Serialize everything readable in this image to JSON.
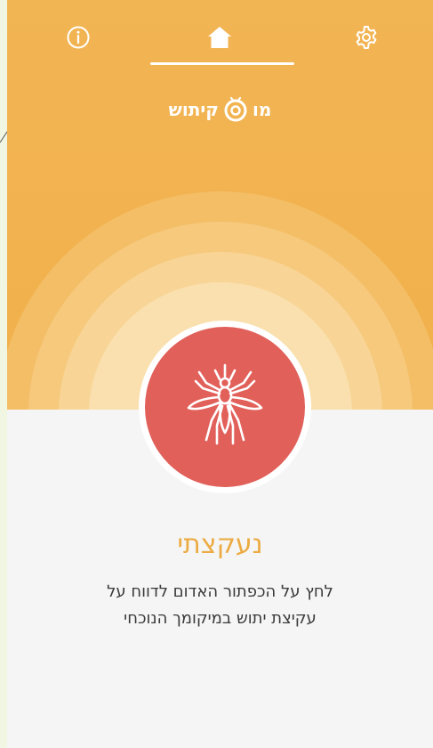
{
  "nav": {
    "info_icon": "info-icon",
    "home_icon": "home-icon",
    "settings_icon": "gear-icon",
    "active_tab": "home"
  },
  "logo": {
    "text_right": "מו",
    "text_left": "קיתוש",
    "mark_icon": "target-logo-icon"
  },
  "report_button": {
    "icon": "mosquito-icon"
  },
  "main": {
    "title": "נעקצתי",
    "description_line1": "לחץ על הכפתור האדום לדווח על",
    "description_line2": "עקיצת יתוש במיקומך הנוכחי"
  },
  "colors": {
    "header_orange": "#f1b04b",
    "accent_red": "#e2605a",
    "title_orange": "#ecab43",
    "body_bg": "#f5f5f5",
    "side_strip": "#f1f6e3"
  }
}
